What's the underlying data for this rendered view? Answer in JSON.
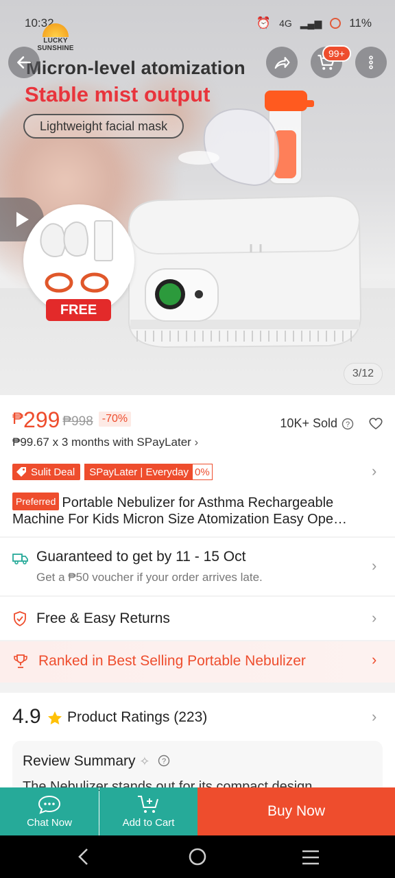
{
  "status_bar": {
    "time": "10:32",
    "network": "4G",
    "battery": "11%"
  },
  "hero": {
    "brand": "LUCKY SUNSHINE",
    "headline": "Micron-level atomization",
    "subheadline": "Stable mist output",
    "pill": "Lightweight facial mask",
    "free_badge": "FREE",
    "image_counter": "3/12",
    "cart_badge": "99+"
  },
  "price": {
    "currency": "₱",
    "current": "299",
    "original": "₱998",
    "discount": "-70%",
    "sold": "10K+ Sold",
    "installment": "₱99.67 x 3 months with SPayLater"
  },
  "tags": {
    "sulit": "Sulit Deal",
    "spaylater": "SPayLater | Everyday",
    "spaylater_rate": "0%"
  },
  "product": {
    "preferred_badge": "Preferred",
    "title": "Portable Nebulizer for Asthma Rechargeable Machine For Kids Micron Size Atomization Easy Ope…"
  },
  "shipping": {
    "title": "Guaranteed to get by 11 - 15 Oct",
    "subtitle": "Get a ₱50 voucher if your order arrives late."
  },
  "returns": {
    "title": "Free & Easy Returns"
  },
  "ranking": {
    "title": "Ranked in Best Selling Portable Nebulizer"
  },
  "ratings": {
    "score": "4.9",
    "label": "Product Ratings (223)",
    "summary_title": "Review Summary",
    "summary_text": "The Nebulizer stands out for its compact design"
  },
  "actions": {
    "chat": "Chat Now",
    "cart": "Add to Cart",
    "buy": "Buy Now"
  },
  "colors": {
    "brand_orange": "#ee4d2d",
    "teal": "#26aa99"
  }
}
